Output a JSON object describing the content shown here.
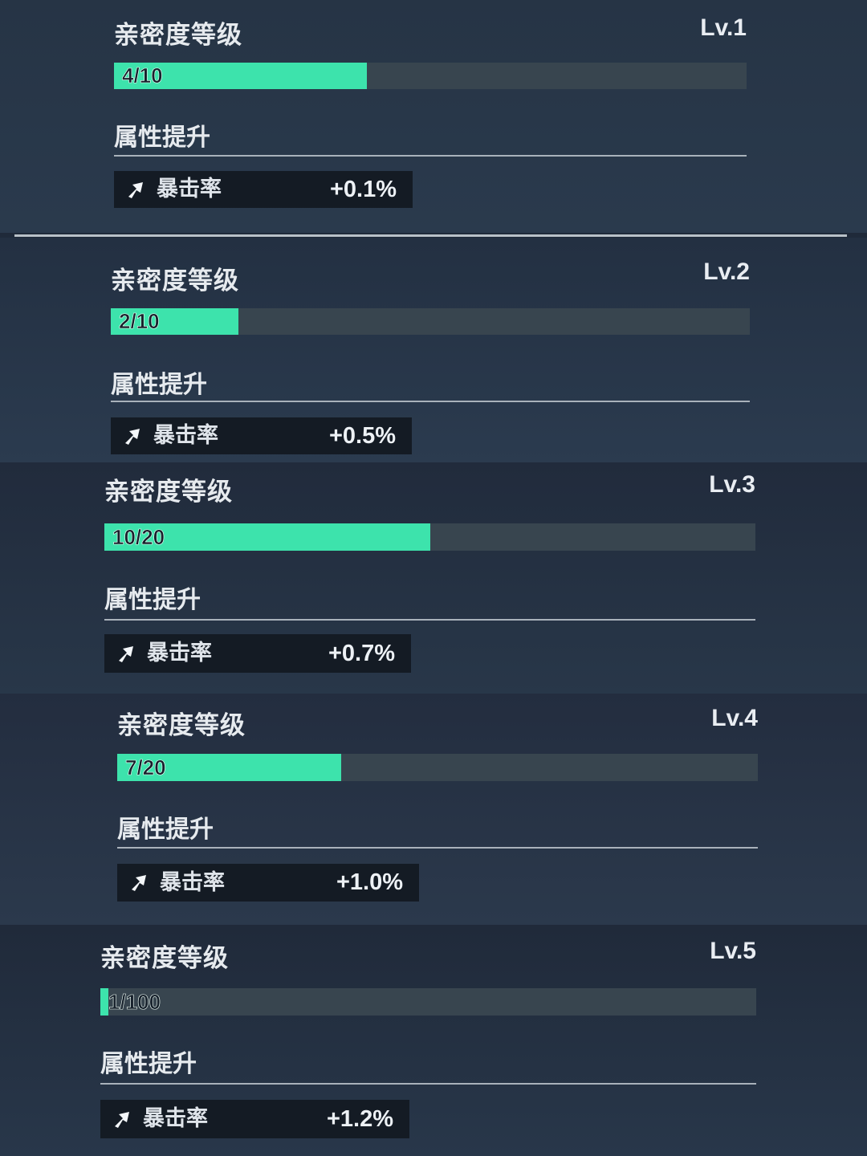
{
  "colors": {
    "bar_fill": "#3de3ac",
    "bar_track": "#38454f",
    "stat_bg": "#141b24"
  },
  "levels": [
    {
      "heading": "亲密度等级",
      "level": "Lv.1",
      "progress_text": "4/10",
      "progress": 0.4,
      "attr_heading": "属性提升",
      "stat_icon": "arrow-up-right-icon",
      "stat_name": "暴击率",
      "stat_value": "+0.1%"
    },
    {
      "heading": "亲密度等级",
      "level": "Lv.2",
      "progress_text": "2/10",
      "progress": 0.2,
      "attr_heading": "属性提升",
      "stat_icon": "arrow-up-right-icon",
      "stat_name": "暴击率",
      "stat_value": "+0.5%"
    },
    {
      "heading": "亲密度等级",
      "level": "Lv.3",
      "progress_text": "10/20",
      "progress": 0.5,
      "attr_heading": "属性提升",
      "stat_icon": "arrow-up-right-icon",
      "stat_name": "暴击率",
      "stat_value": "+0.7%"
    },
    {
      "heading": "亲密度等级",
      "level": "Lv.4",
      "progress_text": "7/20",
      "progress": 0.35,
      "attr_heading": "属性提升",
      "stat_icon": "arrow-up-right-icon",
      "stat_name": "暴击率",
      "stat_value": "+1.0%"
    },
    {
      "heading": "亲密度等级",
      "level": "Lv.5",
      "progress_text": "1/100",
      "progress": 0.01,
      "attr_heading": "属性提升",
      "stat_icon": "arrow-up-right-icon",
      "stat_name": "暴击率",
      "stat_value": "+1.2%"
    }
  ]
}
